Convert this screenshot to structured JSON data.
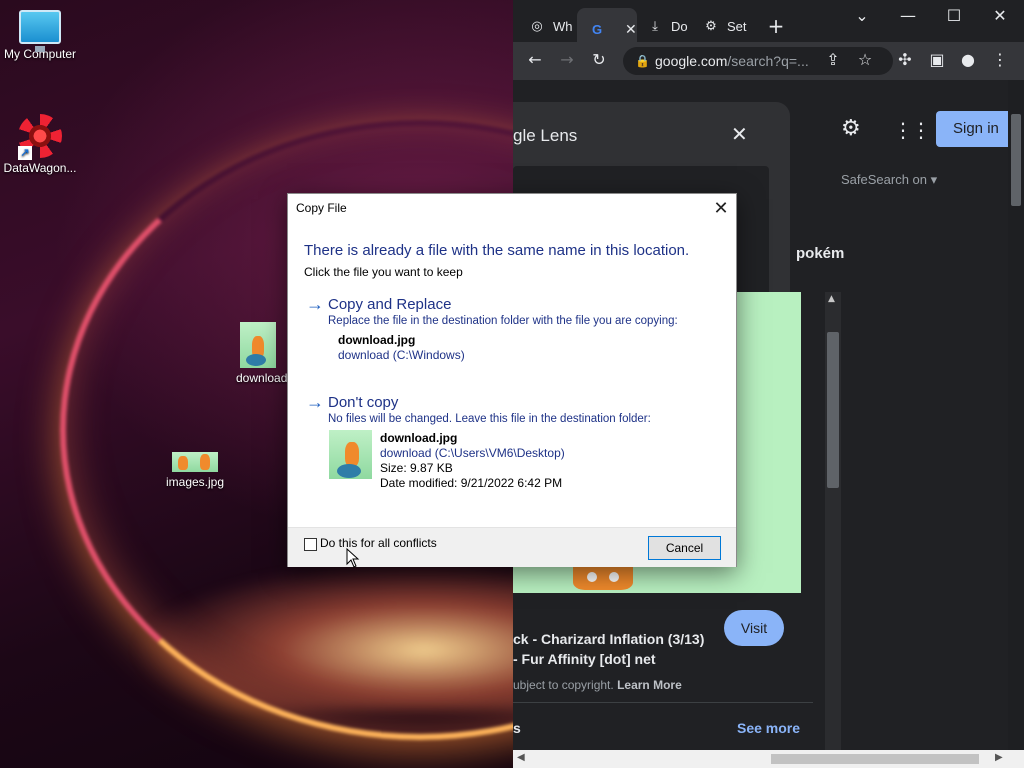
{
  "desktop": {
    "icons": [
      {
        "label": "My Computer",
        "icon": "monitor-icon"
      },
      {
        "label": "DataWagon...",
        "icon": "datawagon-logo-icon"
      },
      {
        "label": "download",
        "icon": "image-file-icon"
      },
      {
        "label": "images.jpg",
        "icon": "image-file-icon"
      }
    ]
  },
  "browser": {
    "tabs": [
      {
        "label": "Wh",
        "icon": "chrome-icon"
      },
      {
        "label": "",
        "icon": "google-icon",
        "close": "✕"
      },
      {
        "label": "Do",
        "icon": "download-icon"
      },
      {
        "label": "Set",
        "icon": "gear-icon"
      }
    ],
    "new_tab": "+",
    "window_controls": {
      "dropdown": "⌄",
      "minimize": "—",
      "maximize": "☐",
      "close": "✕"
    },
    "omnibox": {
      "host": "google.com",
      "path": "/search?q=..."
    },
    "page": {
      "lens_title": "gle Lens",
      "lens_close": "✕",
      "signin": "Sign in",
      "safesearch": "SafeSearch on ▾",
      "chip": "pokém",
      "visit": "Visit",
      "result_title_1": "ck - Charizard Inflation (3/13)",
      "result_title_2": "- Fur Affinity [dot] net",
      "result_copyright": "ubject to copyright.",
      "learn_more": "Learn More",
      "section_s": "s",
      "see_more": "See more"
    }
  },
  "dialog": {
    "title": "Copy File",
    "close": "✕",
    "heading": "There is already a file with the same name in this location.",
    "subheading": "Click the file you want to keep",
    "option_replace": {
      "title": "Copy and Replace",
      "desc": "Replace the file in the destination folder with the file you are copying:",
      "file_name": "download.jpg",
      "file_path": "download (C:\\Windows)"
    },
    "option_skip": {
      "title": "Don't copy",
      "desc": "No files will be changed. Leave this file in the destination folder:",
      "file_name": "download.jpg",
      "file_path": "download (C:\\Users\\VM6\\Desktop)",
      "size": "Size: 9.87 KB",
      "date_modified": "Date modified: 9/21/2022 6:42 PM"
    },
    "checkbox_label": "Do this for all conflicts",
    "checkbox_checked": false,
    "cancel": "Cancel"
  },
  "colors": {
    "dialog_text_blue": "#1e3287",
    "accent_blue": "#0078d7",
    "chrome_bg": "#202124",
    "link_blue": "#8ab4f8"
  }
}
